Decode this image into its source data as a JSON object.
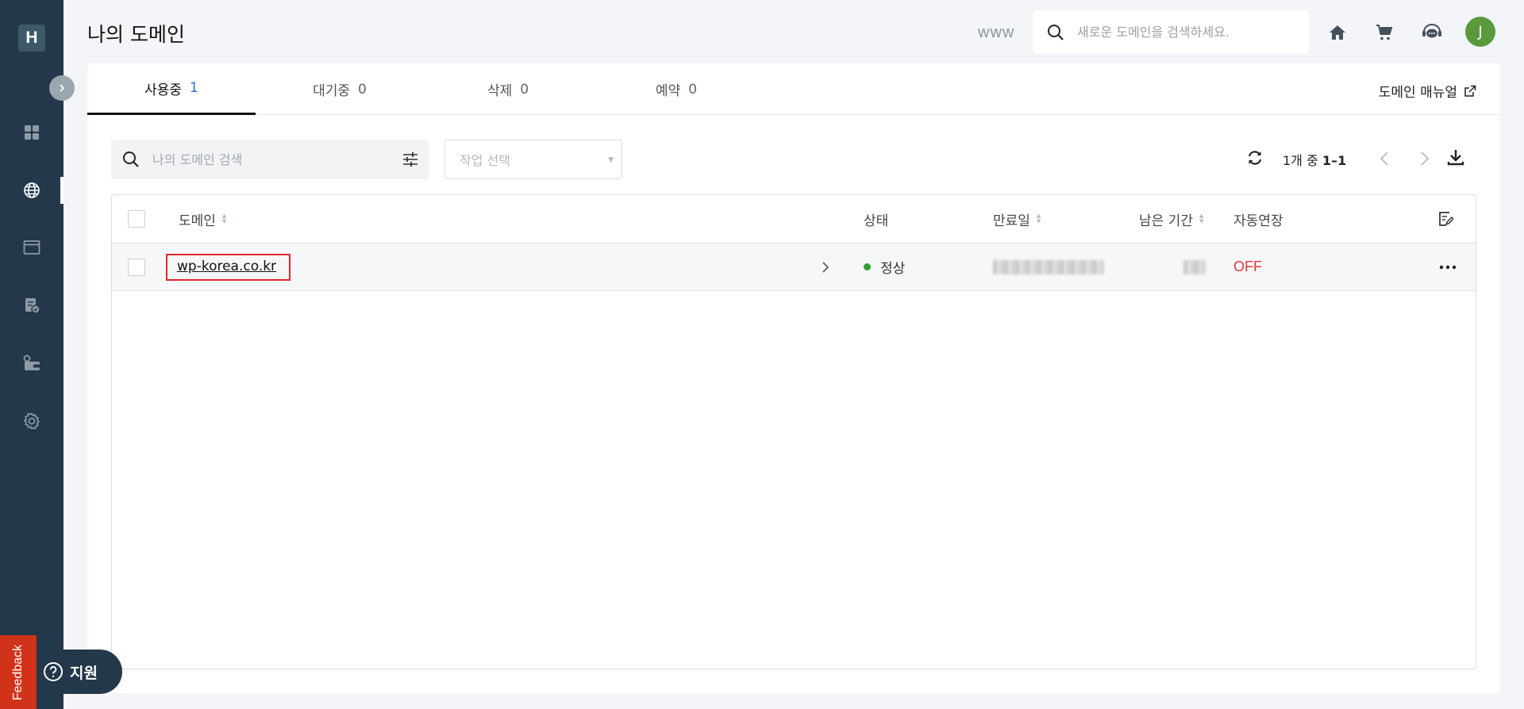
{
  "sidebar": {
    "logo": "H",
    "items": [
      {
        "icon": "dashboard-grid-icon"
      },
      {
        "icon": "globe-icon",
        "active": true
      },
      {
        "icon": "browser-window-icon"
      },
      {
        "icon": "document-check-icon"
      },
      {
        "icon": "wallet-icon"
      },
      {
        "icon": "gear-icon"
      }
    ]
  },
  "feedback_label": "Feedback",
  "support_label": "지원",
  "header": {
    "title": "나의 도메인",
    "www_label": "www",
    "search_placeholder": "새로운 도메인을 검색하세요.",
    "avatar_initial": "J"
  },
  "tabs": [
    {
      "label": "사용중",
      "count": "1",
      "active": true
    },
    {
      "label": "대기중",
      "count": "0"
    },
    {
      "label": "삭제",
      "count": "0"
    },
    {
      "label": "예약",
      "count": "0"
    }
  ],
  "manual_link": "도메인 매뉴얼",
  "filter": {
    "search_placeholder": "나의 도메인 검색",
    "action_placeholder": "작업 선택"
  },
  "pager": {
    "prefix": "1개 중",
    "range": "1–1"
  },
  "table": {
    "columns": {
      "domain": "도메인",
      "status": "상태",
      "expiry": "만료일",
      "remaining": "남은 기간",
      "auto_renew": "자동연장"
    },
    "rows": [
      {
        "domain": "wp-korea.co.kr",
        "status": "정상",
        "auto_renew": "OFF"
      }
    ]
  },
  "colors": {
    "sidebar_bg": "#23384a",
    "accent_blue": "#1e6fe8",
    "status_green": "#2ea02e",
    "off_red": "#e53535",
    "highlight_red": "#e3262b"
  }
}
